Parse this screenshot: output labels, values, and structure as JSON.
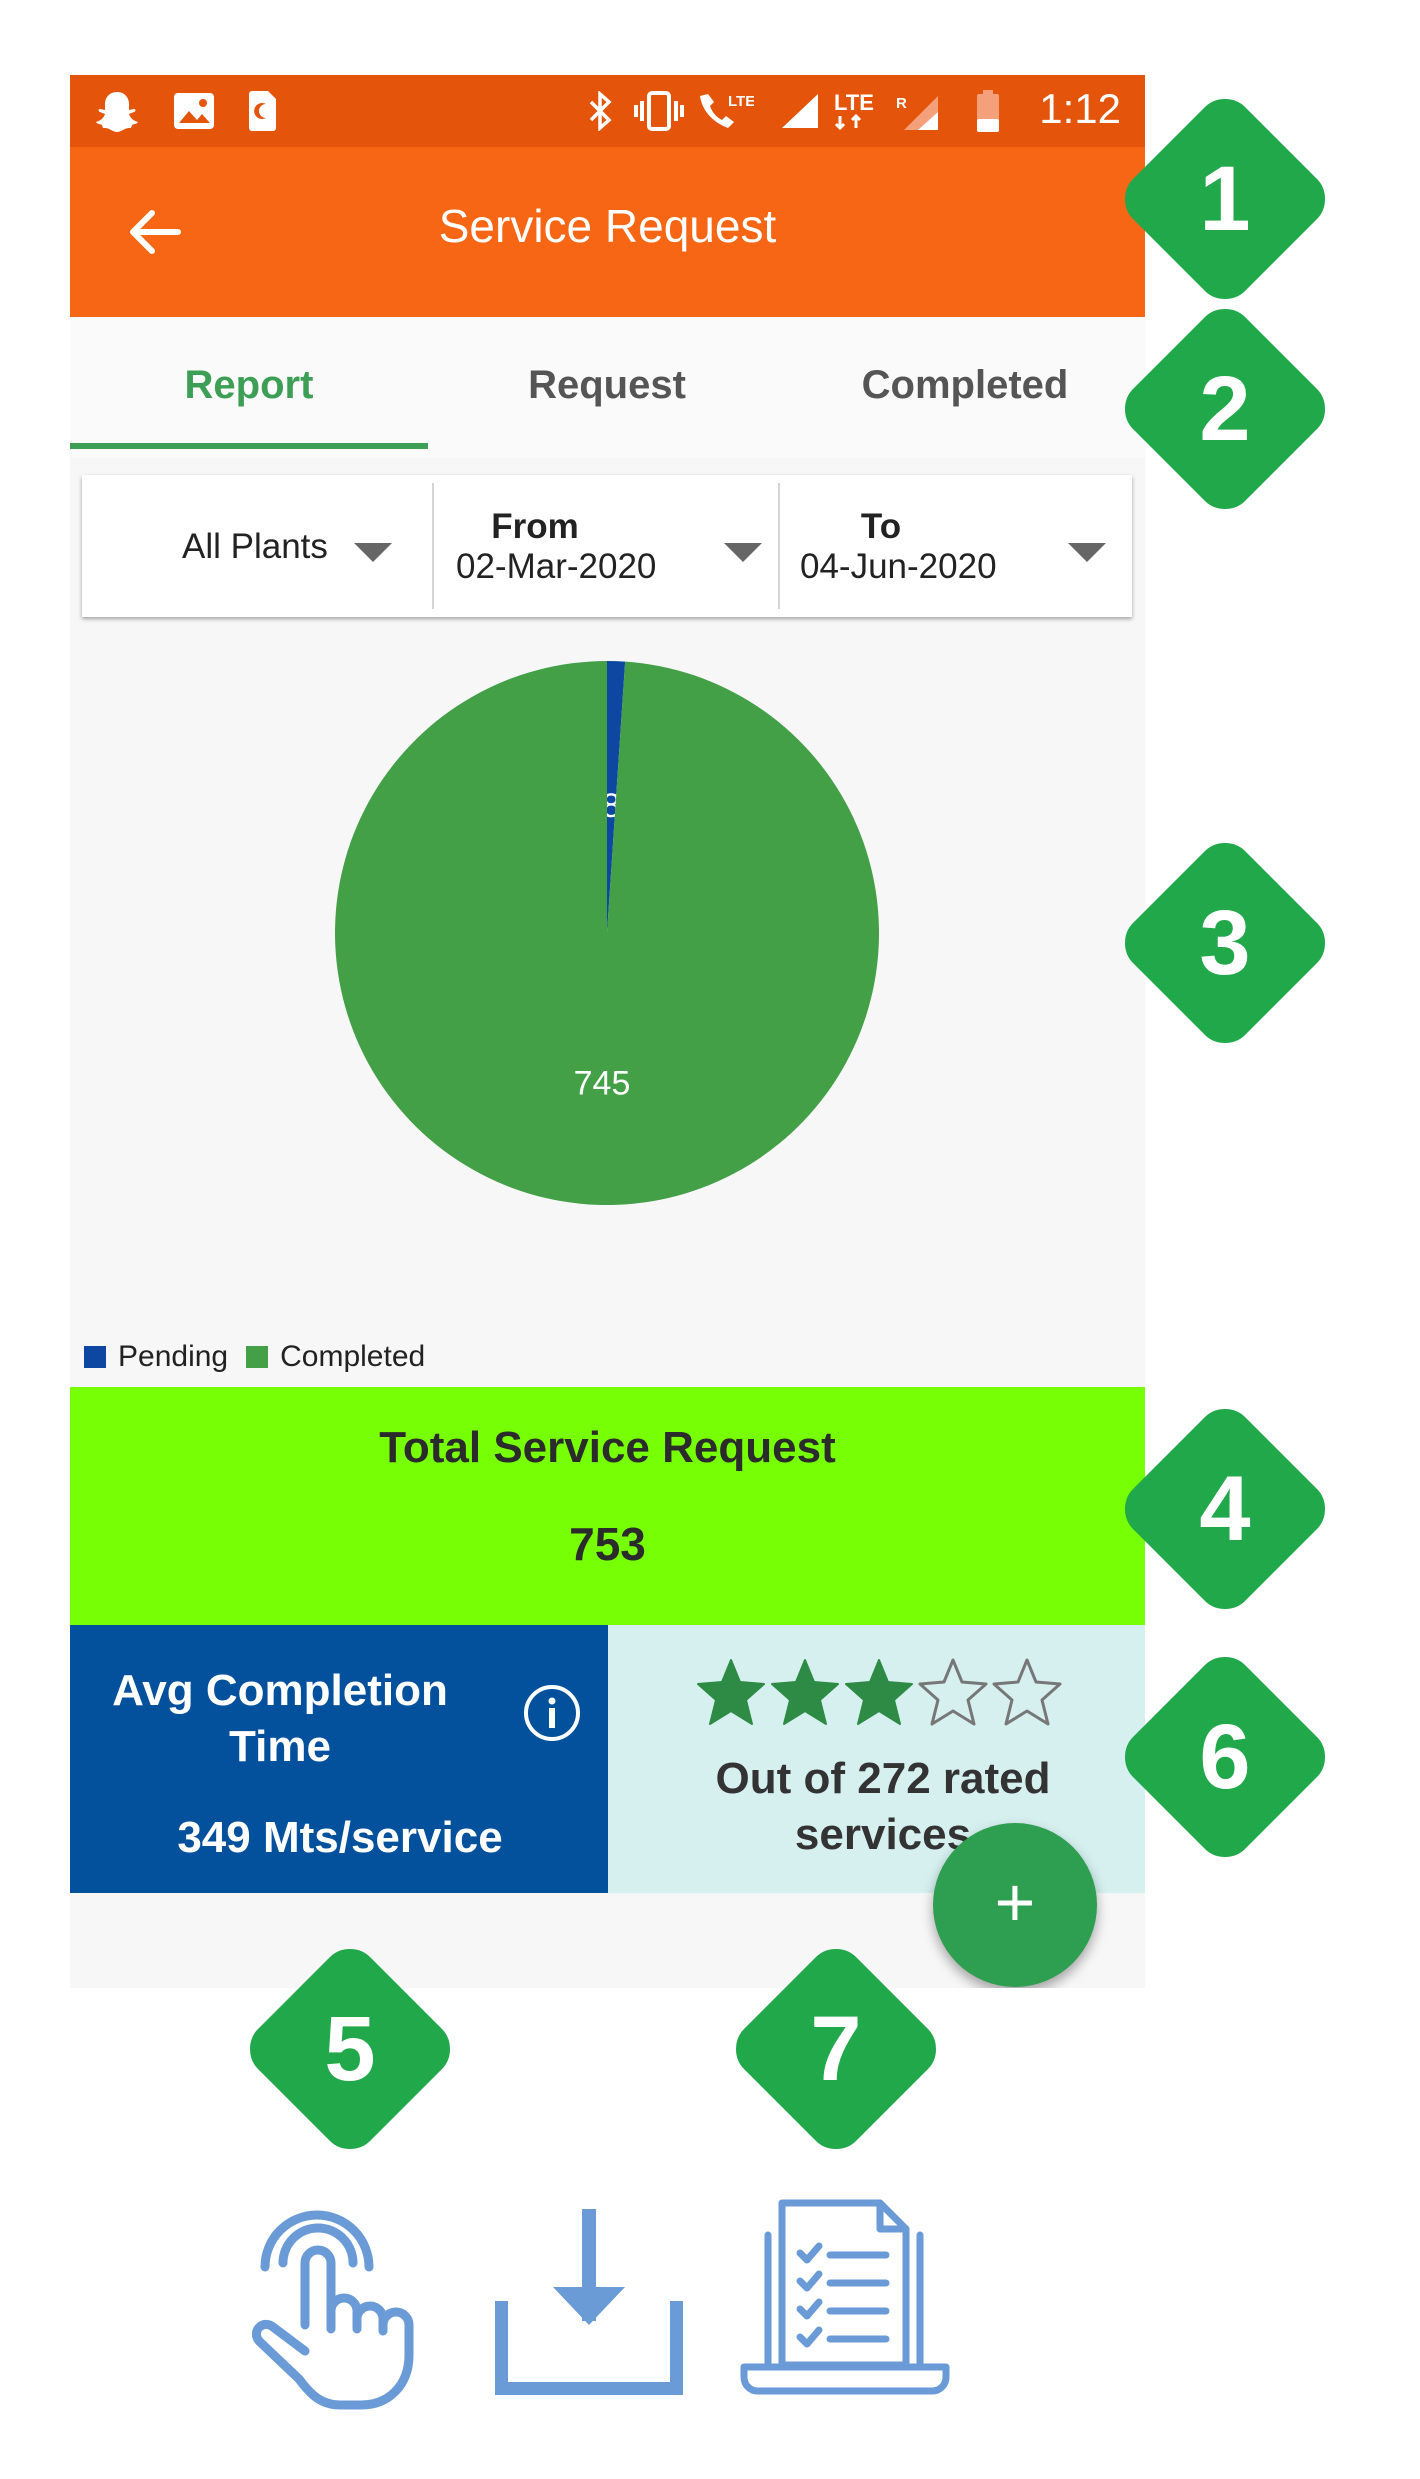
{
  "status_bar": {
    "time": "1:12",
    "icons": [
      "snapchat-icon",
      "image-icon",
      "sim-icon",
      "bluetooth-icon",
      "vibrate-icon",
      "volte-icon",
      "signal-icon",
      "lte-signal-icon",
      "battery-icon"
    ],
    "lte_label": "LTE",
    "lte2_label": "LTE",
    "roaming_label": "R"
  },
  "toolbar": {
    "title": "Service Request",
    "back_icon": "arrow-left-icon"
  },
  "tabs": [
    {
      "label": "Report",
      "active": true
    },
    {
      "label": "Request",
      "active": false
    },
    {
      "label": "Completed",
      "active": false
    }
  ],
  "filters": {
    "plant": {
      "value": "All Plants"
    },
    "from": {
      "label": "From",
      "value": "02-Mar-2020"
    },
    "to": {
      "label": "To",
      "value": "04-Jun-2020"
    }
  },
  "chart_data": {
    "type": "pie",
    "labels": [
      "Pending",
      "Completed"
    ],
    "values": [
      8,
      745
    ],
    "colors": [
      "#0d47a1",
      "#43a047"
    ],
    "legend_position": "bottom-left"
  },
  "summary": {
    "total_label": "Total Service Request",
    "total_value": "753",
    "avg_label": "Avg Completion Time",
    "avg_value": "349 Mts/service",
    "rating_stars": 3,
    "rating_max": 5,
    "rating_text_line1": "Out of 272 rated",
    "rating_text_line2": "services"
  },
  "fab_label": "+",
  "badges": [
    "1",
    "2",
    "3",
    "4",
    "5",
    "6",
    "7"
  ],
  "colors": {
    "status_bar": "#e4540b",
    "toolbar": "#f76614",
    "tab_active": "#3d9e55",
    "total_panel": "#77ff05",
    "avg_panel": "#03519c",
    "rating_panel": "#d6f0f0",
    "badge": "#20a84a",
    "fab": "#2e9e50",
    "bottom_icons": "#6b9bd6"
  },
  "bottom_icons": [
    "touch-icon",
    "download-icon",
    "report-list-icon"
  ]
}
